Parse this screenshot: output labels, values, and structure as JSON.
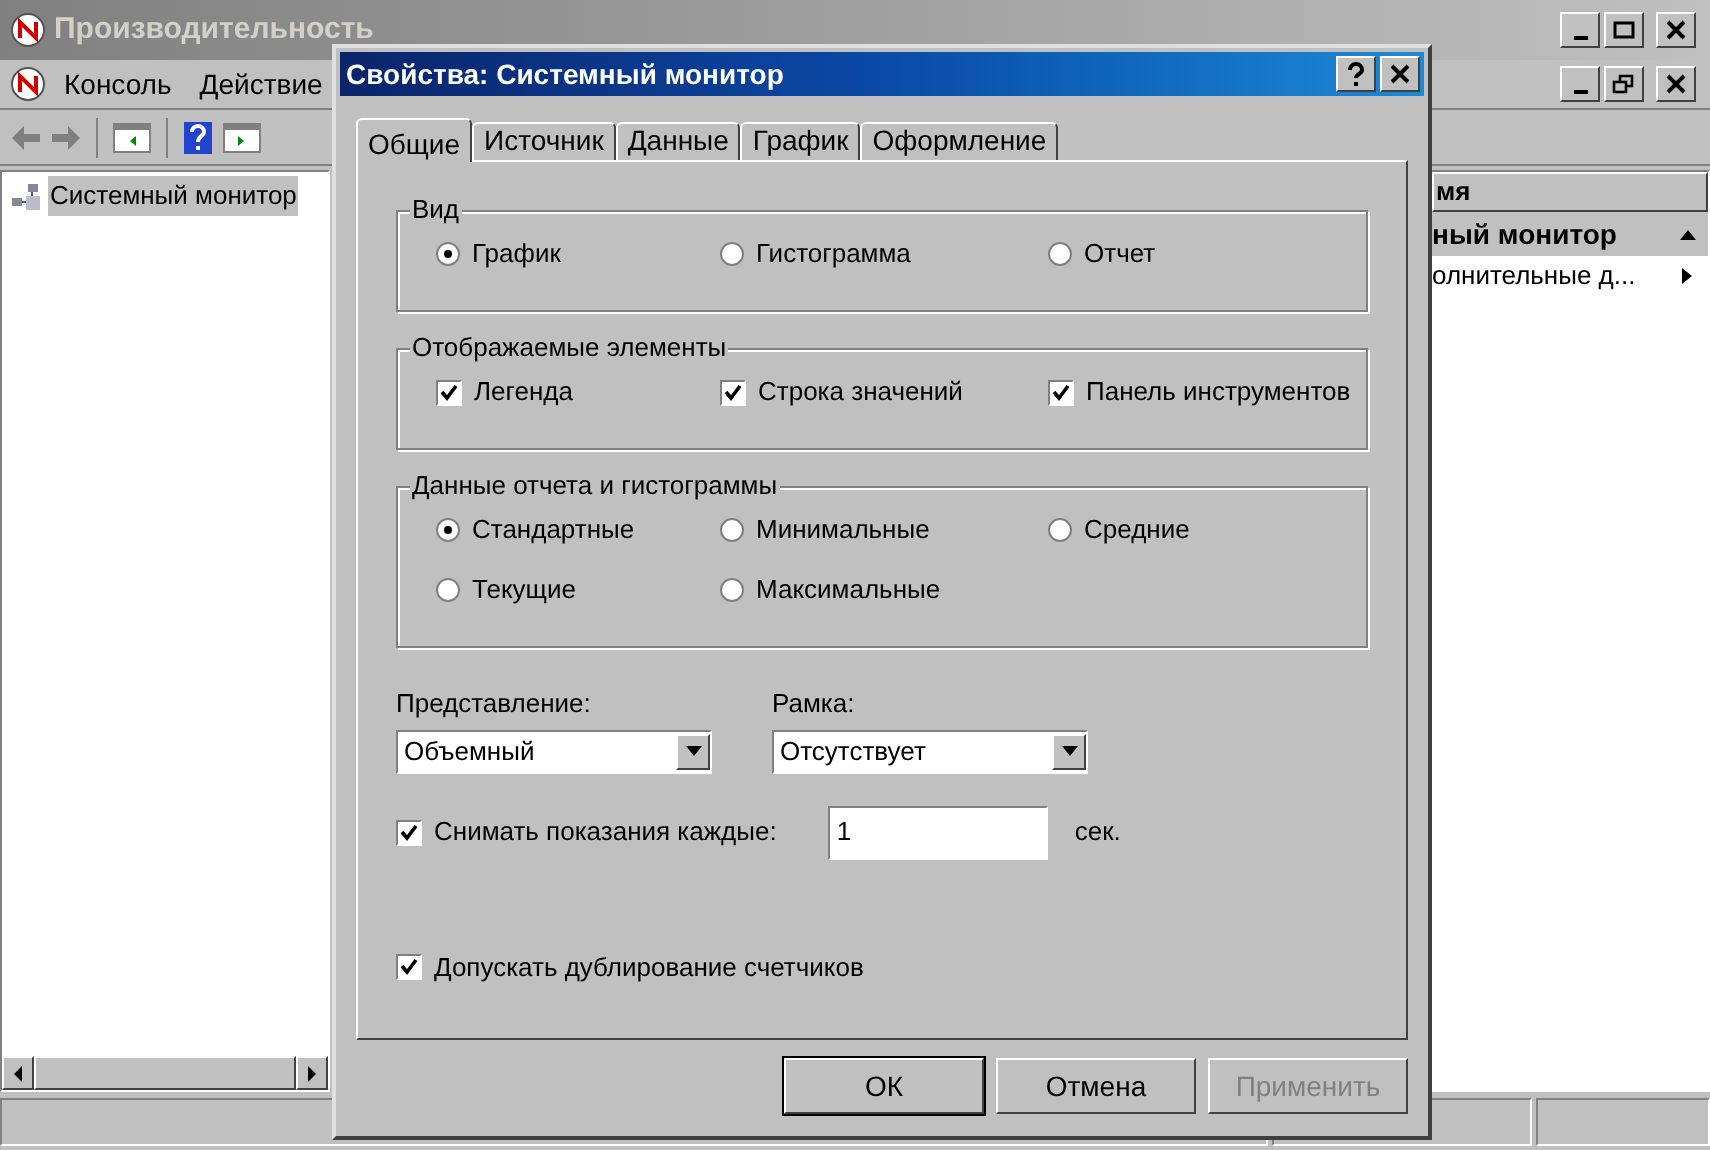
{
  "main_window": {
    "title": "Производительность",
    "menu": [
      "Консоль",
      "Действие"
    ],
    "tree": [
      {
        "label": "Системный монитор",
        "selected": true
      }
    ],
    "list_header": "мя",
    "list_rows": [
      {
        "label": "ный монитор",
        "kind": "group"
      },
      {
        "label": "олнительные д...",
        "kind": "item"
      }
    ]
  },
  "dialog": {
    "title": "Свойства: Системный монитор",
    "tabs": [
      {
        "label": "Общие",
        "selected": true
      },
      {
        "label": "Источник",
        "selected": false
      },
      {
        "label": "Данные",
        "selected": false
      },
      {
        "label": "График",
        "selected": false
      },
      {
        "label": "Оформление",
        "selected": false
      }
    ],
    "groups": [
      {
        "title": "Вид",
        "kind": "radio",
        "items": [
          {
            "label": "График",
            "selected": true
          },
          {
            "label": "Гистограмма",
            "selected": false
          },
          {
            "label": "Отчет",
            "selected": false
          }
        ]
      },
      {
        "title": "Отображаемые элементы",
        "kind": "checkbox",
        "items": [
          {
            "label": "Легенда",
            "checked": true
          },
          {
            "label": "Строка значений",
            "checked": true
          },
          {
            "label": "Панель инструментов",
            "checked": true
          }
        ]
      },
      {
        "title": "Данные отчета и гистограммы",
        "kind": "radio",
        "items": [
          {
            "label": "Стандартные",
            "selected": true
          },
          {
            "label": "Минимальные",
            "selected": false
          },
          {
            "label": "Средние",
            "selected": false
          },
          {
            "label": "Текущие",
            "selected": false
          },
          {
            "label": "Максимальные",
            "selected": false
          }
        ]
      }
    ],
    "combos": [
      {
        "label": "Представление:",
        "value": "Объемный"
      },
      {
        "label": "Рамка:",
        "value": "Отсутствует"
      }
    ],
    "sample": {
      "label": "Снимать показания каждые:",
      "checked": true,
      "value": "1",
      "unit": "сек."
    },
    "allow_duplicates": {
      "label": "Допускать дублирование счетчиков",
      "checked": true
    },
    "buttons": [
      {
        "label": "ОК",
        "disabled": false
      },
      {
        "label": "Отмена",
        "disabled": false
      },
      {
        "label": "Применить",
        "disabled": true
      }
    ]
  }
}
